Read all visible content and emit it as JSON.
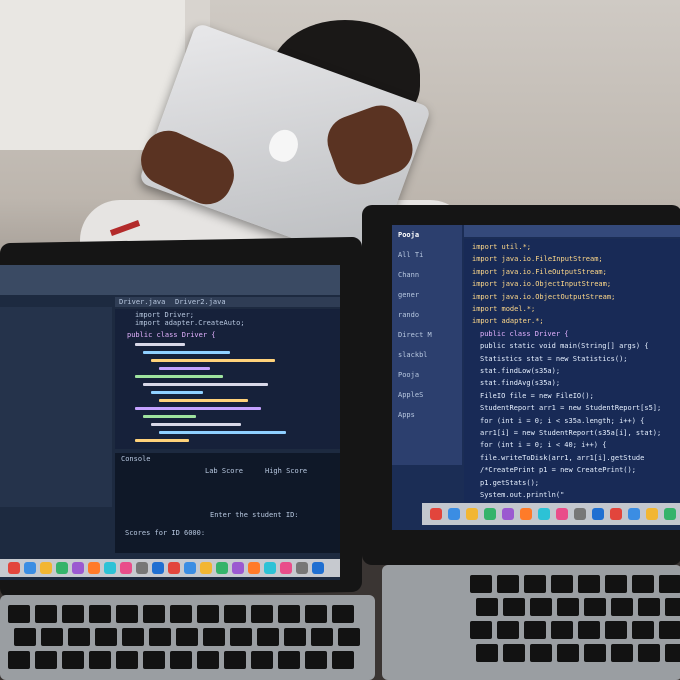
{
  "left_screen": {
    "tabs": [
      "Driver.java",
      "Driver2.java"
    ],
    "header_lines": [
      "import Driver;",
      "import adapter.CreateAuto;"
    ],
    "class_line": "public class Driver {",
    "console_tab": "Console",
    "console_columns": [
      "Lab Score",
      "High Score"
    ],
    "console_prompt": "Enter the student ID:",
    "console_footer": "Scores for ID 6000:"
  },
  "right_screen": {
    "user": "Pooja",
    "code_lines": [
      "import util.*;",
      "import java.io.FileInputStream;",
      "import java.io.FileOutputStream;",
      "import java.io.ObjectInputStream;",
      "import java.io.ObjectOutputStream;",
      "import model.*;",
      "import adapter.*;",
      "public class Driver {",
      "public static void main(String[] args) {",
      "Statistics stat = new Statistics();",
      "stat.findLow(s35a);",
      "stat.findAvg(s35a);",
      "FileIO file = new FileIO();",
      "StudentReport arr1 = new StudentReport[s5];",
      "for (int i = 0; i < s35a.length; i++) {",
      "arr1[i] = new StudentReport(s35a[i], stat);",
      "for (int i = 0; i < 40; i++) {",
      "file.writeToDisk(arr1, arr1[i].getStude",
      "/*CreatePrint p1 = new CreatePrint();",
      "p1.getStats();",
      "System.out.println(\""
    ],
    "sidebar_items": [
      "All Ti",
      "Chann",
      "gener",
      "rando",
      "Direct M",
      "slackbl",
      "Pooja",
      "AppleS",
      "Apps"
    ]
  }
}
